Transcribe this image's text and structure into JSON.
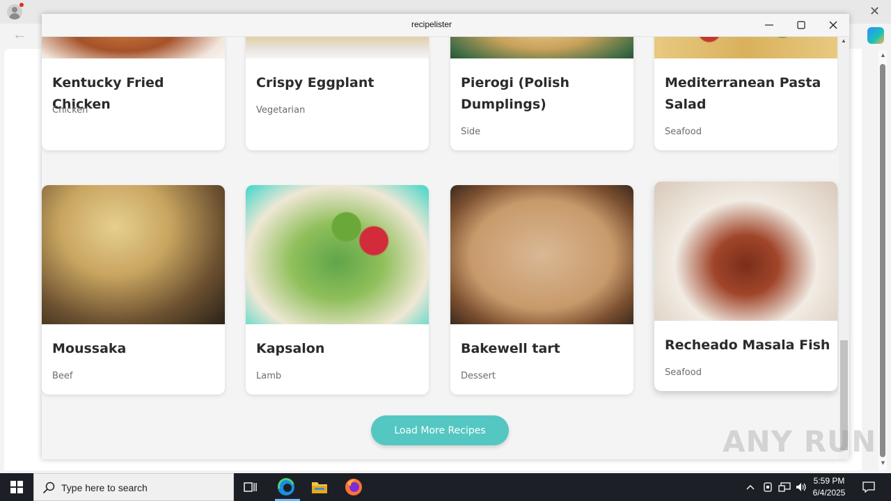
{
  "app": {
    "title": "recipelister",
    "load_more_label": "Load More Recipes"
  },
  "recipes_row1": [
    {
      "name": "Kentucky Fried Chicken",
      "category": "Chicken"
    },
    {
      "name": "Crispy Eggplant",
      "category": "Vegetarian"
    },
    {
      "name": "Pierogi (Polish Dumplings)",
      "category": "Side"
    },
    {
      "name": "Mediterranean Pasta Salad",
      "category": "Seafood"
    }
  ],
  "recipes_row2": [
    {
      "name": "Moussaka",
      "category": "Beef"
    },
    {
      "name": "Kapsalon",
      "category": "Lamb"
    },
    {
      "name": "Bakewell tart",
      "category": "Dessert"
    },
    {
      "name": "Recheado Masala Fish",
      "category": "Seafood"
    }
  ],
  "watermark": "ANY RUN",
  "taskbar": {
    "search_placeholder": "Type here to search",
    "time": "5:59 PM",
    "date": "6/4/2025"
  },
  "colors": {
    "accent": "#54c7c2",
    "taskbar": "#1c2026"
  }
}
